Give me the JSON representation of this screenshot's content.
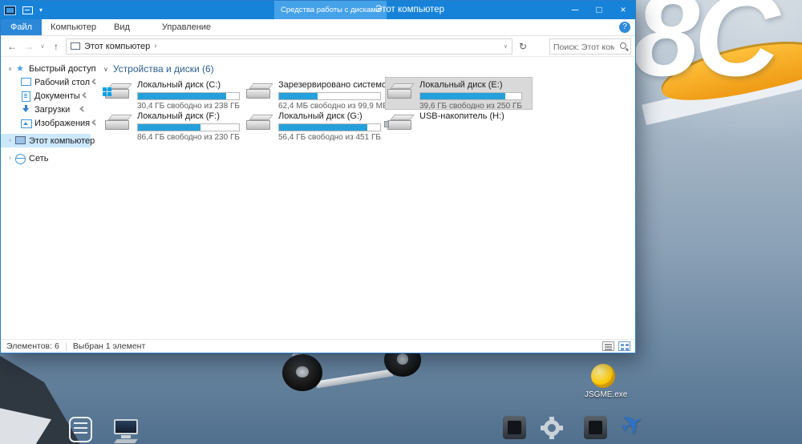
{
  "window": {
    "title": "Этот компьютер",
    "contextual_tab_label": "Средства работы с дисками"
  },
  "ribbon": {
    "tabs": [
      {
        "label": "Файл"
      },
      {
        "label": "Компьютер"
      },
      {
        "label": "Вид"
      },
      {
        "label": "Управление"
      }
    ],
    "help_label": "?"
  },
  "address_bar": {
    "breadcrumb_root": "Этот компьютер",
    "search_placeholder": "Поиск: Этот компью..."
  },
  "sidebar": {
    "quick_access": {
      "label": "Быстрый доступ",
      "items": [
        {
          "label": "Рабочий стол"
        },
        {
          "label": "Документы"
        },
        {
          "label": "Загрузки"
        },
        {
          "label": "Изображения"
        }
      ]
    },
    "this_pc_label": "Этот компьютер",
    "network_label": "Сеть"
  },
  "content": {
    "group_header": "Устройства и диски (6)",
    "drives": [
      {
        "name": "Локальный диск (C:)",
        "free_text": "30,4 ГБ свободно из 238 ГБ",
        "used_percent": 87
      },
      {
        "name": "Зарезервировано системой (D:)",
        "free_text": "62,4 МБ свободно из 99,9 МБ",
        "used_percent": 38
      },
      {
        "name": "Локальный диск (E:)",
        "free_text": "39,6 ГБ свободно из 250 ГБ",
        "used_percent": 84
      },
      {
        "name": "Локальный диск (F:)",
        "free_text": "86,4 ГБ свободно из 230 ГБ",
        "used_percent": 62
      },
      {
        "name": "Локальный диск (G:)",
        "free_text": "56,4 ГБ свободно из 451 ГБ",
        "used_percent": 87
      },
      {
        "name": "USB-накопитель (H:)",
        "free_text": "",
        "used_percent": null
      }
    ]
  },
  "status_bar": {
    "items_text": "Элементов: 6",
    "selection_text": "Выбран 1 элемент"
  },
  "desktop": {
    "registration_marking": "8C",
    "icons": [
      {
        "label": "JSGME.exe"
      }
    ]
  },
  "icons": {
    "minimize": "─",
    "maximize": "□",
    "close": "×",
    "back": "←",
    "forward": "→",
    "up": "↑",
    "chevron_down": "∨",
    "chevron_right": "›",
    "dropdown": "▾",
    "refresh": "↻",
    "star": "★",
    "airplane": "✈"
  }
}
